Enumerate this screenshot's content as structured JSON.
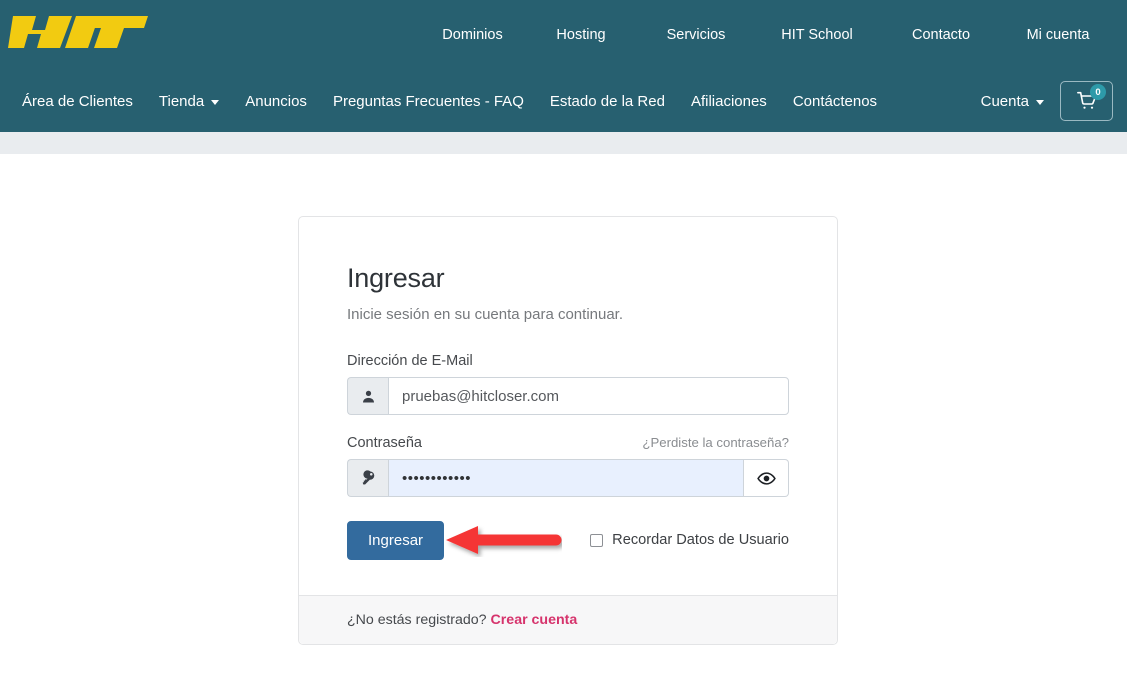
{
  "brand": {
    "logo_text": "HIT",
    "logo_color": "#f2cb11",
    "header_bg": "#276070"
  },
  "topnav": {
    "items": [
      {
        "label": "Dominios",
        "name": "dominios"
      },
      {
        "label": "Hosting",
        "name": "hosting"
      },
      {
        "label": "Servicios",
        "name": "servicios"
      },
      {
        "label": "HIT School",
        "name": "hit-school"
      },
      {
        "label": "Contacto",
        "name": "contacto"
      },
      {
        "label": "Mi cuenta",
        "name": "mi-cuenta"
      }
    ]
  },
  "subnav": {
    "left_items": [
      {
        "label": "Área de Clientes",
        "name": "area-de-clientes",
        "dropdown": false
      },
      {
        "label": "Tienda",
        "name": "tienda",
        "dropdown": true
      },
      {
        "label": "Anuncios",
        "name": "anuncios",
        "dropdown": false
      },
      {
        "label": "Preguntas Frecuentes - FAQ",
        "name": "preguntas-frecuentes-faq",
        "dropdown": false
      },
      {
        "label": "Estado de la Red",
        "name": "estado-de-la-red",
        "dropdown": false
      },
      {
        "label": "Afiliaciones",
        "name": "afiliaciones",
        "dropdown": false
      },
      {
        "label": "Contáctenos",
        "name": "contactenos",
        "dropdown": false
      }
    ],
    "account_label": "Cuenta",
    "cart_icon": "shopping-cart-icon",
    "cart_count": "0",
    "cart_badge_color": "#2d9aa9"
  },
  "login": {
    "title": "Ingresar",
    "subtitle": "Inicie sesión en su cuenta para continuar.",
    "email": {
      "label": "Dirección de E-Mail",
      "icon": "user-icon",
      "value": "pruebas@hitcloser.com",
      "placeholder": "Dirección de E-Mail"
    },
    "password": {
      "label": "Contraseña",
      "forgot_label": "¿Perdiste la contraseña?",
      "icon": "key-icon",
      "value": "••••••••••••",
      "placeholder": "Contraseña",
      "toggle_icon": "eye-icon",
      "autofill_color": "#e8f0fe"
    },
    "submit_label": "Ingresar",
    "submit_color": "#336b9e",
    "remember_label": "Recordar Datos de Usuario",
    "remember_checked": false,
    "footer_text": "¿No estás registrado?",
    "footer_link": "Crear cuenta",
    "footer_link_color": "#d6336c"
  },
  "annotation": {
    "arrow": "red-left-arrow",
    "color": "#f53535",
    "points_to": "Ingresar"
  }
}
